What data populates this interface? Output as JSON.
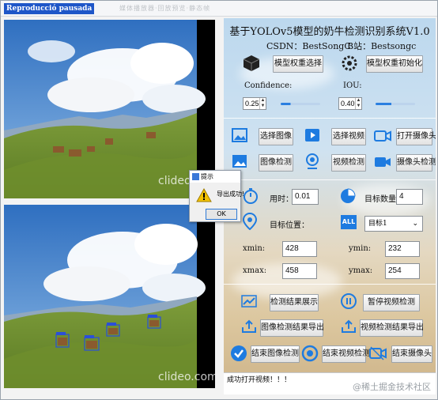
{
  "window": {
    "title_main": "Reproducció pausada",
    "title_ghost": "媒体播放器·回放预览·静态帧"
  },
  "video_panels": {
    "top_watermark": "clideo.com",
    "bottom_watermark": "clideo.com"
  },
  "header": {
    "system_name": "基于YOLOv5模型的奶牛检测识别系统V1.0",
    "csdn": "CSDN：BestSongC",
    "bilibili": "B站：Bestsongc"
  },
  "model": {
    "select_weights": "模型权重选择",
    "init_weights": "模型权重初始化"
  },
  "params": {
    "confidence_label": "Confidence:",
    "confidence_value": "0.25",
    "iou_label": "IOU:",
    "iou_value": "0.40",
    "confidence_fraction": 0.25,
    "iou_fraction": 0.4
  },
  "actions": {
    "select_image": "选择图像",
    "select_video": "选择视频",
    "open_camera": "打开摄像头",
    "image_detect": "图像检测",
    "video_detect": "视频检测",
    "camera_detect": "摄像头检测"
  },
  "results": {
    "time_label": "用时：",
    "time_value": "0.01",
    "count_label": "目标数量：",
    "count_value": "4",
    "position_label": "目标位置：",
    "target_select": "目标1",
    "xmin_label": "xmin:",
    "xmin_value": "428",
    "ymin_label": "ymin:",
    "ymin_value": "232",
    "xmax_label": "xmax:",
    "xmax_value": "458",
    "ymax_label": "ymax:",
    "ymax_value": "254"
  },
  "bottom": {
    "show_results": "检测结果展示",
    "pause_video": "暂停视频检测",
    "export_image": "图像检测结果导出",
    "export_video": "视频检测结果导出",
    "end_image": "结束图像检测",
    "end_video": "结束视频检测",
    "end_camera": "结束摄像头"
  },
  "status": {
    "text": "成功打开视频！！！",
    "watermark": "@稀土掘金技术社区"
  },
  "dialog": {
    "title": "提示",
    "message": "导出成功!",
    "ok": "OK"
  },
  "colors": {
    "accent_blue": "#1e7be0",
    "title_blue": "#1e56c8"
  }
}
